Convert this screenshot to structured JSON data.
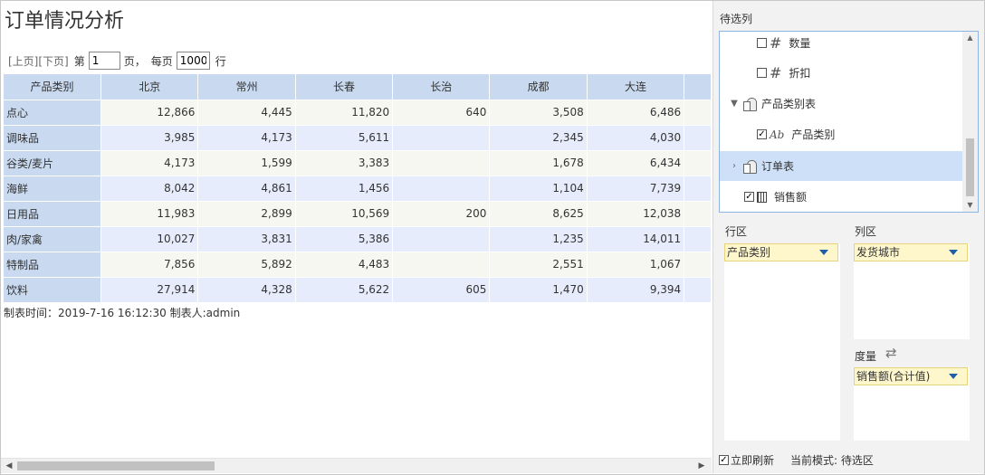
{
  "report": {
    "title": "订单情况分析",
    "pager": {
      "prev": "[上页]",
      "next": "[下页]",
      "page_prefix": "第",
      "page_value": "1",
      "page_suffix": "页，",
      "size_prefix": "每页",
      "size_value": "1000",
      "size_suffix": "行"
    },
    "table": {
      "corner": "产品类别",
      "columns": [
        "北京",
        "常州",
        "长春",
        "长治",
        "成都",
        "大连"
      ],
      "rows": [
        {
          "label": "点心",
          "values": [
            "12,866",
            "4,445",
            "11,820",
            "640",
            "3,508",
            "6,486"
          ]
        },
        {
          "label": "调味品",
          "values": [
            "3,985",
            "4,173",
            "5,611",
            "",
            "2,345",
            "4,030"
          ]
        },
        {
          "label": "谷类/麦片",
          "values": [
            "4,173",
            "1,599",
            "3,383",
            "",
            "1,678",
            "6,434"
          ]
        },
        {
          "label": "海鲜",
          "values": [
            "8,042",
            "4,861",
            "1,456",
            "",
            "1,104",
            "7,739"
          ]
        },
        {
          "label": "日用品",
          "values": [
            "11,983",
            "2,899",
            "10,569",
            "200",
            "8,625",
            "12,038"
          ]
        },
        {
          "label": "肉/家禽",
          "values": [
            "10,027",
            "3,831",
            "5,386",
            "",
            "1,235",
            "14,011"
          ]
        },
        {
          "label": "特制品",
          "values": [
            "7,856",
            "5,892",
            "4,483",
            "",
            "2,551",
            "1,067"
          ]
        },
        {
          "label": "饮料",
          "values": [
            "27,914",
            "4,328",
            "5,622",
            "605",
            "1,470",
            "9,394"
          ]
        }
      ]
    },
    "footer_note": "制表时间：2019-7-16 16:12:30 制表人:admin"
  },
  "panel": {
    "candidates_label": "待选列",
    "tree": {
      "qty": "数量",
      "discount": "折扣",
      "category_table": "产品类别表",
      "category_field": "产品类别",
      "order_table": "订单表",
      "sales": "销售额"
    },
    "row_zone_label": "行区",
    "row_chip": "产品类别",
    "col_zone_label": "列区",
    "col_chip": "发货城市",
    "measure_label": "度量",
    "measure_chip": "销售额(合计值)",
    "refresh_label": "立即刷新",
    "mode_text": "当前模式: 待选区"
  }
}
